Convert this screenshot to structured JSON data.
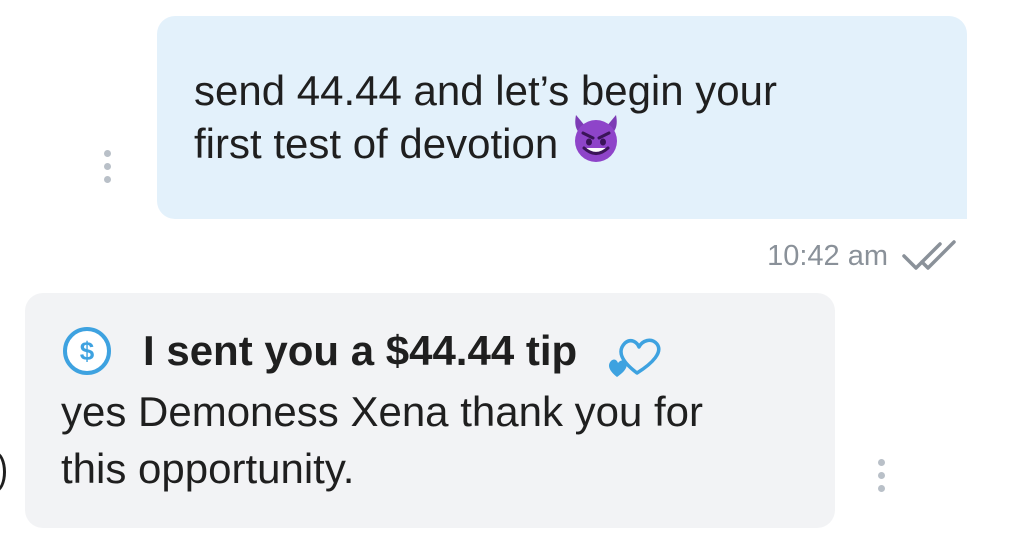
{
  "messages": [
    {
      "direction": "outgoing",
      "lines": [
        "send 44.44 and let’s begin your",
        "first test of devotion"
      ],
      "emoji": "smiling-imp-emoji",
      "timestamp": "10:42 am",
      "status_icon": "double-check-icon"
    },
    {
      "direction": "incoming",
      "tip": {
        "text": "I sent you a $44.44 tip",
        "icon": "dollar-circle-icon",
        "decoration": "hearts-icon"
      },
      "lines": [
        "yes Demoness Xena thank you for",
        "this opportunity."
      ]
    }
  ],
  "colors": {
    "outgoing_bubble": "#e3f1fb",
    "incoming_bubble": "#f2f3f5",
    "accent": "#3ea2e0",
    "timestamp": "#8a9199"
  }
}
